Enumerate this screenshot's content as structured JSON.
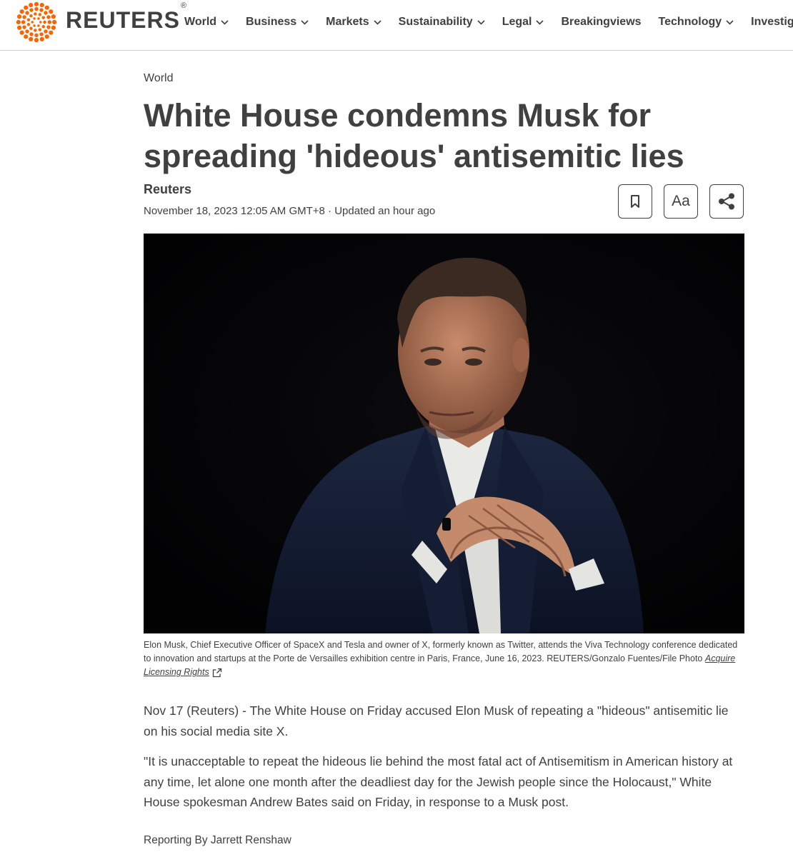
{
  "header": {
    "brand": "REUTERS",
    "registered": "®",
    "nav": [
      {
        "label": "World",
        "has_dropdown": true
      },
      {
        "label": "Business",
        "has_dropdown": true
      },
      {
        "label": "Markets",
        "has_dropdown": true
      },
      {
        "label": "Sustainability",
        "has_dropdown": true
      },
      {
        "label": "Legal",
        "has_dropdown": true
      },
      {
        "label": "Breakingviews",
        "has_dropdown": false
      },
      {
        "label": "Technology",
        "has_dropdown": true
      },
      {
        "label": "Investigations",
        "has_dropdown": false
      }
    ],
    "icons": {
      "logo": "reuters-dot-ring-logo",
      "dropdown": "chevron-down-icon"
    },
    "accent_color": "#fa6400"
  },
  "article": {
    "section": "World",
    "headline": "White House condemns Musk for spreading 'hideous' antisemitic lies",
    "byline": "Reuters",
    "dateline": "November 18, 2023 12:05 AM GMT+8 · Updated an hour ago",
    "tools": {
      "bookmark_icon": "bookmark-icon",
      "font_size_label": "Aa",
      "share_icon": "share-icon"
    },
    "photo_caption": "Elon Musk, Chief Executive Officer of SpaceX and Tesla and owner of X, formerly known as Twitter, attends the Viva Technology conference dedicated to innovation and startups at the Porte de Versailles exhibition centre in Paris, France, June 16, 2023. REUTERS/Gonzalo Fuentes/File Photo",
    "licensing_link": "Acquire Licensing Rights",
    "paragraphs": [
      "Nov 17 (Reuters) - The White House on Friday accused Elon Musk of repeating a \"hideous\" antisemitic lie on his social media site X.",
      "\"It is unacceptable to repeat the hideous lie behind the most fatal act of Antisemitism in American history at any time, let alone one month after the deadliest day for the Jewish people since the Holocaust,\" White House spokesman Andrew Bates said on Friday, in response to a Musk post."
    ],
    "reporting": "Reporting By Jarrett Renshaw"
  }
}
